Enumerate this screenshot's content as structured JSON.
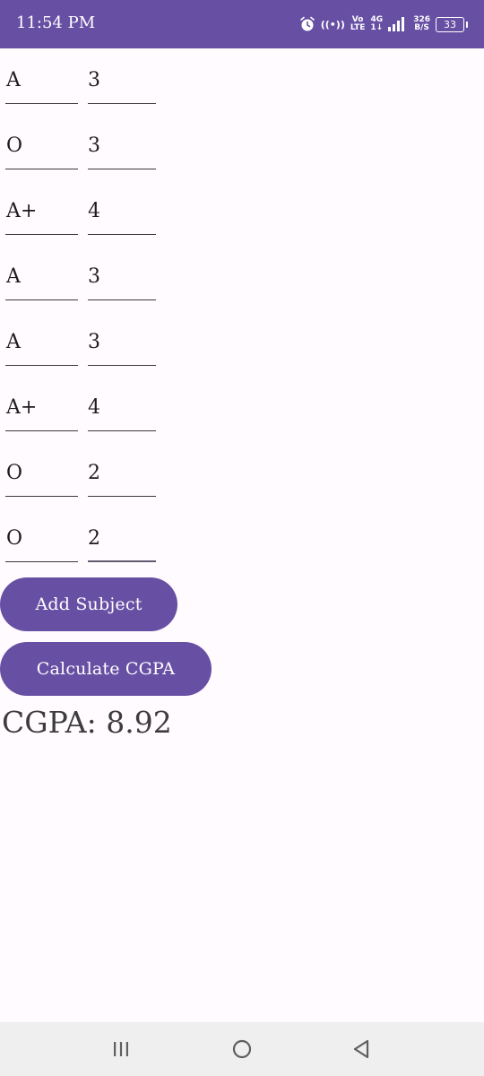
{
  "status_bar": {
    "time": "11:54 PM",
    "volte_top": "Vo",
    "volte_bottom": "LTE",
    "network_type": "4G",
    "network_sub": "1↓",
    "speed_value": "326",
    "speed_unit": "B/S",
    "battery_level": "33",
    "icons": [
      "alarm-icon",
      "hotspot-icon",
      "volte-icon",
      "signal-icon",
      "battery-icon"
    ]
  },
  "subjects": [
    {
      "grade": "A",
      "credits": "3"
    },
    {
      "grade": "O",
      "credits": "3"
    },
    {
      "grade": "A+",
      "credits": "4"
    },
    {
      "grade": "A",
      "credits": "3"
    },
    {
      "grade": "A",
      "credits": "3"
    },
    {
      "grade": "A+",
      "credits": "4"
    },
    {
      "grade": "O",
      "credits": "2"
    },
    {
      "grade": "O",
      "credits": "2"
    }
  ],
  "buttons": {
    "add_subject": "Add Subject",
    "calculate": "Calculate CGPA"
  },
  "result": {
    "text": "CGPA: 8.92"
  },
  "nav_bar": {
    "icons": [
      "recents-icon",
      "home-icon",
      "back-icon"
    ]
  },
  "colors": {
    "primary": "#6750a4",
    "background": "#fffbfe",
    "nav_background": "#efefef"
  }
}
